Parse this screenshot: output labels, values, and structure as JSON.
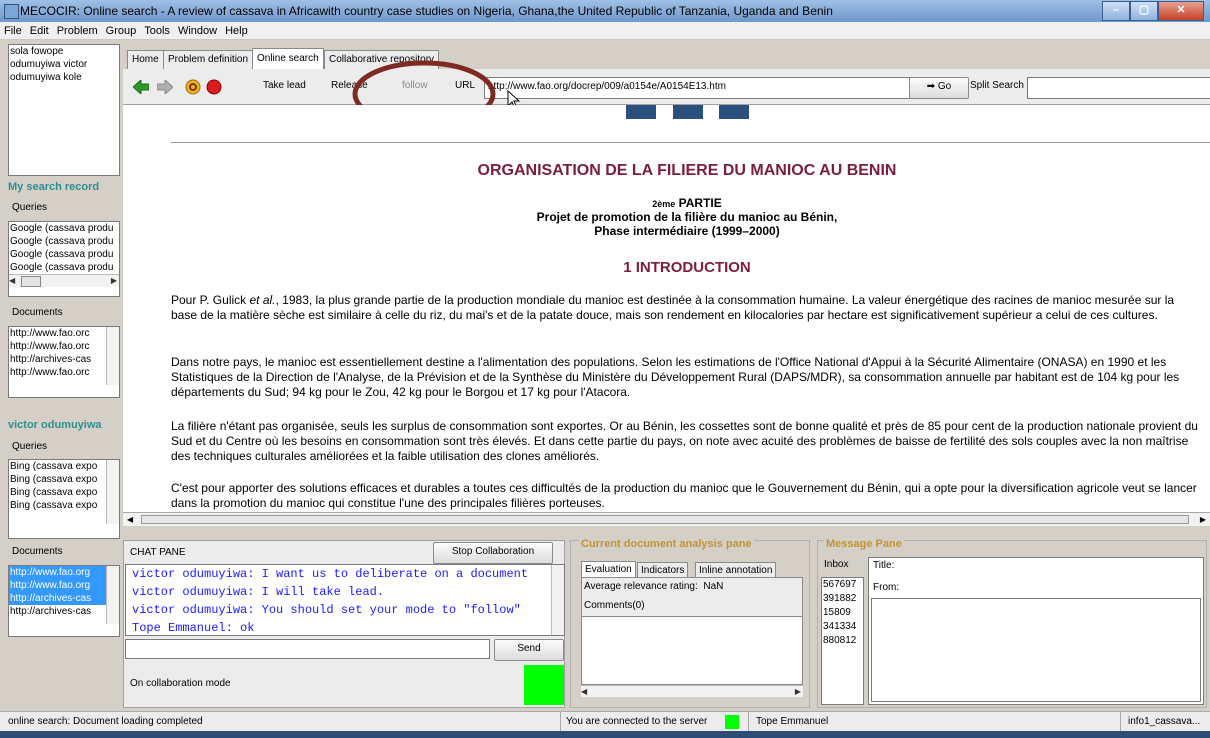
{
  "window": {
    "title": "MECOCIR: Online search - A review of cassava in Africawith country case studies on Nigeria, Ghana,the United Republic of Tanzania, Uganda and Benin",
    "controls": [
      "–",
      "▢",
      "✕"
    ]
  },
  "menubar": [
    "File",
    "Edit",
    "Problem",
    "Group",
    "Tools",
    "Window",
    "Help"
  ],
  "users": [
    "sola fowope",
    "odumuyiwa victor",
    "odumuyiwa kole"
  ],
  "my_search_record": {
    "title": "My search record",
    "queries_label": "Queries",
    "queries": [
      "Google (cassava produ",
      "Google (cassava produ",
      "Google (cassava produ",
      "Google (cassava produ"
    ],
    "documents_label": "Documents",
    "documents": [
      "http://www.fao.orc",
      "http://www.fao.orc",
      "http://archives-cas",
      "http://www.fao.orc"
    ]
  },
  "victor_record": {
    "title": "victor odumuyiwa",
    "queries_label": "Queries",
    "queries": [
      "Bing (cassava expo",
      "Bing (cassava expo",
      "Bing (cassava expo",
      "Bing (cassava expo"
    ],
    "documents_label": "Documents",
    "documents": [
      "http://www.fao.org",
      "http://www.fao.org",
      "http://archives-cas",
      "http://archives-cas"
    ]
  },
  "tabs": [
    "Home",
    "Problem definition",
    "Online search",
    "Collaborative repository"
  ],
  "toolbar": {
    "take_lead": "Take lead",
    "release": "Release",
    "follow": "follow",
    "url_label": "URL",
    "url_value": "http://www.fao.org/docrep/009/a0154e/A0154E13.htm",
    "go": "Go",
    "split_search": "Split Search"
  },
  "document": {
    "title": "ORGANISATION DE LA FILIERE DU MANIOC AU BENIN",
    "part_small": "2ème",
    "part": "PARTIE",
    "subtitle1": "Projet de promotion de la filière du manioc au Bénin,",
    "subtitle2": "Phase intermédiaire (1999–2000)",
    "section": "1 INTRODUCTION",
    "p1_a": "Pour P. Gulick ",
    "p1_em": "et al.",
    "p1_b": ", 1983, la plus grande partie de la production mondiale du manioc est destinée à la consommation humaine. La valeur énergétique des racines de manioc mesurée sur la base de la matière sèche est similaire à celle du riz, du mai's et de la patate douce, mais son rendement en kilocalories par hectare est significativement supérieur a celui de ces cultures.",
    "p2": "Dans notre pays, le manioc est essentiellement destine a l'alimentation des populations. Selon les estimations de l'Office National d'Appui à la Sécurité Alimentaire (ONASA) en 1990 et les Statistiques de la Direction de l'Analyse, de la Prévision et de la Synthèse du Ministère du Développement Rural (DAPS/MDR), sa consommation annuelle par habitant est de 104 kg pour les départements du Sud; 94 kg pour le Zou, 42 kg pour le Borgou et 17 kg pour l'Atacora.",
    "p3": "La filière n'étant pas organisée, seuls les surplus de consommation sont exportes. Or au Bénin, les cossettes sont de bonne qualité et près de 85 pour cent de la production nationale provient du Sud et du Centre où les besoins en consommation sont très élevés. Et dans cette partie du pays, on note avec acuité des problèmes de baisse de fertilité des sols couples avec la non maîtrise des techniques culturales améliorées et la faible utilisation des clones améliorés.",
    "p4": "C'est pour apporter des solutions efficaces et durables a toutes ces difficultés de la production du manioc que le Gouvernement du Bénin, qui a opte pour la diversification agricole veut se lancer dans la promotion du manioc qui constitue l'une des principales filières porteuses."
  },
  "chat": {
    "title": "CHAT PANE",
    "stop_button": "Stop Collaboration",
    "messages": [
      "victor odumuyiwa: I want us to deliberate on a document",
      "victor odumuyiwa: I will take lead.",
      "victor odumuyiwa: You should set your mode to \"follow\"",
      "Tope Emmanuel: ok"
    ],
    "send": "Send",
    "mode": "On collaboration mode",
    "mode_color": "#00ff00"
  },
  "analysis": {
    "title": "Current document analysis pane",
    "tabs": [
      "Evaluation",
      "Indicators",
      "Inline annotation"
    ],
    "rating_label": "Average relevance rating:",
    "rating_value": "NaN",
    "comments": "Comments(0)"
  },
  "messages": {
    "title": "Message Pane",
    "inbox_label": "Inbox",
    "inbox": [
      "567697",
      "391882",
      "15809",
      "341334",
      "880812"
    ],
    "title_label": "Title:",
    "from_label": "From:"
  },
  "statusbar": {
    "left": "online search: Document loading completed",
    "server": "You are connected to the server",
    "server_color": "#00ff00",
    "user": "Tope Emmanuel",
    "right": "info1_cassava..."
  }
}
